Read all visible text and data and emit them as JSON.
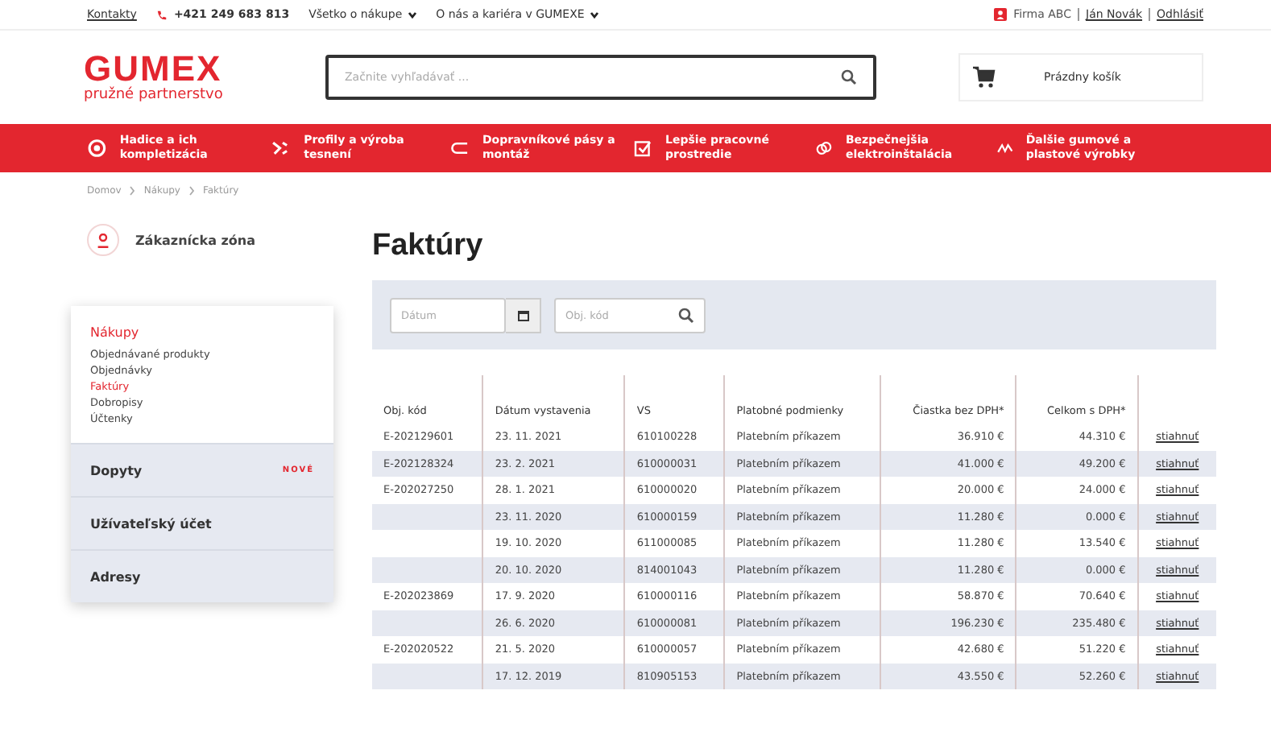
{
  "top_bar": {
    "contacts_link": "Kontakty",
    "phone": "+421 249 683 813",
    "menus": [
      "Všetko o nákupe",
      "O nás a kariéra v GUMEXE"
    ],
    "company": "Firma ABC",
    "user_link": "Ján Novák",
    "logout_link": "Odhlásiť"
  },
  "header": {
    "logo": "GUMEX",
    "tagline": "pružné partnerstvo",
    "search": {
      "placeholder": "Začnite vyhľadávať ..."
    },
    "cart": "Prázdny košík"
  },
  "nav": [
    "Hadice a ich kompletizácia",
    "Profily a výroba tesnení",
    "Dopravníkové pásy a montáž",
    "Lepšie pracovné prostredie",
    "Bezpečnejšia elektroinštalácia",
    "Ďalšie gumové a plastové výrobky"
  ],
  "breadcrumb": [
    "Domov",
    "Nákupy",
    "Faktúry"
  ],
  "sidebar": {
    "title": "Zákaznícka zóna",
    "sections": [
      {
        "label": "Nákupy",
        "expanded": true,
        "items": [
          {
            "label": "Objednávané produkty",
            "selected": false
          },
          {
            "label": "Objednávky",
            "selected": false
          },
          {
            "label": "Faktúry",
            "selected": true
          },
          {
            "label": "Dobropisy",
            "selected": false
          },
          {
            "label": "Účtenky",
            "selected": false
          }
        ]
      },
      {
        "label": "Dopyty",
        "expanded": false,
        "badge": "NOVÉ"
      },
      {
        "label": "Užívateľský účet",
        "expanded": false
      },
      {
        "label": "Adresy",
        "expanded": false
      }
    ]
  },
  "page_title": "Faktúry",
  "filters": {
    "date": {
      "placeholder": "Dátum"
    },
    "code": {
      "placeholder": "Obj. kód"
    }
  },
  "table": {
    "columns": [
      "Obj. kód",
      "Dátum vystavenia",
      "VS",
      "Platobné podmienky",
      "Čiastka bez DPH*",
      "Celkom s DPH*"
    ],
    "rows": [
      {
        "cells": [
          "E-202129601",
          "23. 11. 2021",
          "610100228",
          "Platebním příkazem",
          "36.910 €",
          "44.310 €"
        ],
        "link": "stiahnuť"
      },
      {
        "cells": [
          "E-202128324",
          "23. 2. 2021",
          "610000031",
          "Platebním příkazem",
          "41.000 €",
          "49.200 €"
        ],
        "link": "stiahnuť"
      },
      {
        "cells": [
          "E-202027250",
          "28. 1. 2021",
          "610000020",
          "Platebním příkazem",
          "20.000 €",
          "24.000 €"
        ],
        "link": "stiahnuť"
      },
      {
        "cells": [
          "",
          "23. 11. 2020",
          "610000159",
          "Platebním příkazem",
          "11.280 €",
          "0.000 €"
        ],
        "link": "stiahnuť"
      },
      {
        "cells": [
          "",
          "19. 10. 2020",
          "611000085",
          "Platebním příkazem",
          "11.280 €",
          "13.540 €"
        ],
        "link": "stiahnuť"
      },
      {
        "cells": [
          "",
          "20. 10. 2020",
          "814001043",
          "Platebním příkazem",
          "11.280 €",
          "0.000 €"
        ],
        "link": "stiahnuť"
      },
      {
        "cells": [
          "E-202023869",
          "17. 9. 2020",
          "610000116",
          "Platebním příkazem",
          "58.870 €",
          "70.640 €"
        ],
        "link": "stiahnuť"
      },
      {
        "cells": [
          "",
          "26. 6. 2020",
          "610000081",
          "Platebním příkazem",
          "196.230 €",
          "235.480 €"
        ],
        "link": "stiahnuť"
      },
      {
        "cells": [
          "E-202020522",
          "21. 5. 2020",
          "610000057",
          "Platebním příkazem",
          "42.680 €",
          "51.220 €"
        ],
        "link": "stiahnuť"
      },
      {
        "cells": [
          "",
          "17. 12. 2019",
          "810905153",
          "Platebním příkazem",
          "43.550 €",
          "52.260 €"
        ],
        "link": "stiahnuť"
      }
    ]
  }
}
